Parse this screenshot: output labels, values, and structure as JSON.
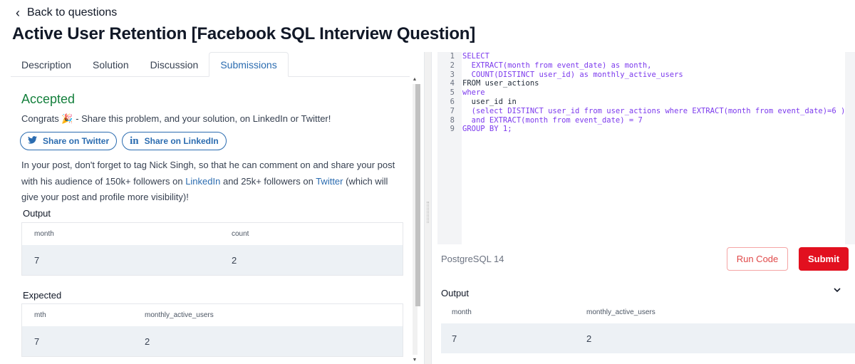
{
  "nav": {
    "back_label": "Back to questions",
    "back_icon": "chevron-left-icon"
  },
  "page": {
    "title": "Active User Retention [Facebook SQL Interview Question]"
  },
  "tabs": [
    {
      "label": "Description"
    },
    {
      "label": "Solution"
    },
    {
      "label": "Discussion"
    },
    {
      "label": "Submissions",
      "active": true
    }
  ],
  "result": {
    "status": "Accepted",
    "status_color": "#15803d",
    "congrats_prefix": "Congrats",
    "congrats_emoji": "🎉",
    "congrats_text": "- Share this problem, and your solution, on LinkedIn or Twitter!",
    "share_twitter": "Share on Twitter",
    "share_linkedin": "Share on LinkedIn",
    "tip_1": "In your post, don't forget to tag Nick Singh, so that he can comment on and share your post with his audience of 150k+ followers on",
    "tip_link_linkedin": "LinkedIn",
    "tip_2": "and 25k+ followers on",
    "tip_link_twitter": "Twitter",
    "tip_3": "(which will give your post and profile more visibility)!"
  },
  "output": {
    "label": "Output",
    "columns": [
      "month",
      "count"
    ],
    "rows": [
      [
        "7",
        "2"
      ]
    ]
  },
  "expected": {
    "label": "Expected",
    "columns": [
      "mth",
      "monthly_active_users"
    ],
    "rows": [
      [
        "7",
        "2"
      ]
    ]
  },
  "editor": {
    "line_numbers": [
      "1",
      "2",
      "3",
      "4",
      "5",
      "6",
      "7",
      "8",
      "9"
    ],
    "lines": [
      "SELECT",
      "  EXTRACT(month from event_date) as month,",
      "  COUNT(DISTINCT user_id) as monthly_active_users",
      "FROM user_actions",
      "where",
      "  user_id in",
      "  (select DISTINCT user_id from user_actions where EXTRACT(month from event_date)=6 )",
      "  and EXTRACT(month from event_date) = 7",
      "GROUP BY 1;"
    ]
  },
  "controls": {
    "language": "PostgreSQL 14",
    "run_label": "Run Code",
    "submit_label": "Submit",
    "submit_color": "#e2101f"
  },
  "run_output": {
    "label": "Output",
    "collapse_icon": "chevron-down-icon",
    "columns": [
      "month",
      "monthly_active_users"
    ],
    "rows": [
      [
        "7",
        "2"
      ]
    ]
  }
}
